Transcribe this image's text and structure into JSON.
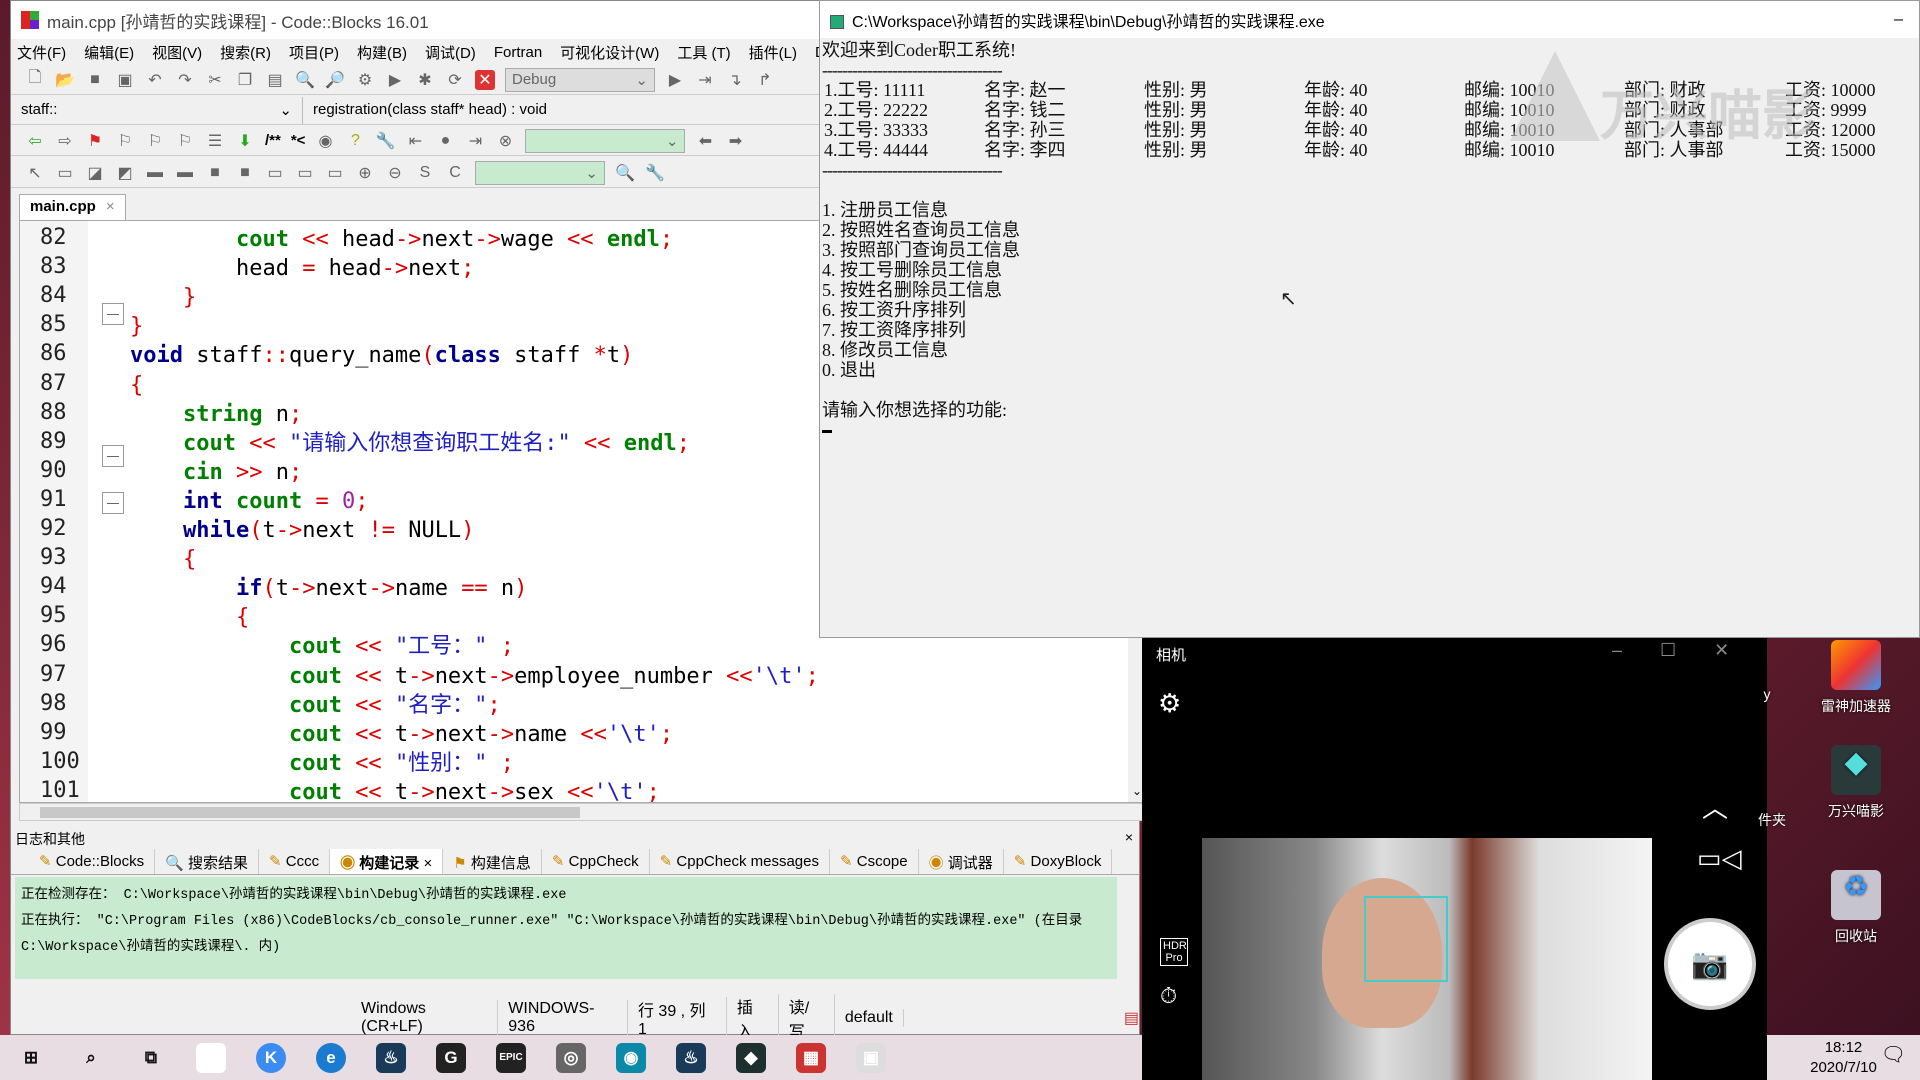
{
  "codeblocks": {
    "title": "main.cpp [孙靖哲的实践课程] - Code::Blocks 16.01",
    "menu": [
      "文件(F)",
      "编辑(E)",
      "视图(V)",
      "搜索(R)",
      "项目(P)",
      "构建(B)",
      "调试(D)",
      "Fortran",
      "可视化设计(W)",
      "工具 (T)",
      "插件(L)",
      "DoxyBl"
    ],
    "build_target": "Debug",
    "scope": "staff::",
    "function": "registration(class staff* head) : void",
    "doc_comment_buttons": [
      "/**",
      "*<"
    ],
    "file_tab": "main.cpp",
    "line_numbers": [
      "82",
      "83",
      "84",
      "85",
      "86",
      "87",
      "88",
      "89",
      "90",
      "91",
      "92",
      "93",
      "94",
      "95",
      "96",
      "97",
      "98",
      "99",
      "100",
      "101"
    ],
    "code": [
      [
        [
          "t",
          "        "
        ],
        [
          "g",
          "cout"
        ],
        [
          "t",
          " "
        ],
        [
          "o",
          "<<"
        ],
        [
          "t",
          " head"
        ],
        [
          "o",
          "->"
        ],
        [
          "t",
          "next"
        ],
        [
          "o",
          "->"
        ],
        [
          "t",
          "wage "
        ],
        [
          "o",
          "<<"
        ],
        [
          "t",
          " "
        ],
        [
          "g",
          "endl"
        ],
        [
          "o",
          ";"
        ]
      ],
      [
        [
          "t",
          "        head "
        ],
        [
          "o",
          "="
        ],
        [
          "t",
          " head"
        ],
        [
          "o",
          "->"
        ],
        [
          "t",
          "next"
        ],
        [
          "o",
          ";"
        ]
      ],
      [
        [
          "t",
          "    "
        ],
        [
          "o",
          "}"
        ]
      ],
      [
        [
          "o",
          "}"
        ]
      ],
      [
        [
          "k",
          "void"
        ],
        [
          "t",
          " staff"
        ],
        [
          "o",
          "::"
        ],
        [
          "t",
          "query_name"
        ],
        [
          "o",
          "("
        ],
        [
          "k",
          "class"
        ],
        [
          "t",
          " staff "
        ],
        [
          "o",
          "*"
        ],
        [
          "t",
          "t"
        ],
        [
          "o",
          ")"
        ]
      ],
      [
        [
          "o",
          "{"
        ]
      ],
      [
        [
          "t",
          "    "
        ],
        [
          "g",
          "string"
        ],
        [
          "t",
          " n"
        ],
        [
          "o",
          ";"
        ]
      ],
      [
        [
          "t",
          "    "
        ],
        [
          "g",
          "cout"
        ],
        [
          "t",
          " "
        ],
        [
          "o",
          "<<"
        ],
        [
          "t",
          " "
        ],
        [
          "s",
          "\"请输入你想查询职工姓名:\""
        ],
        [
          "t",
          " "
        ],
        [
          "o",
          "<<"
        ],
        [
          "t",
          " "
        ],
        [
          "g",
          "endl"
        ],
        [
          "o",
          ";"
        ]
      ],
      [
        [
          "t",
          "    "
        ],
        [
          "g",
          "cin"
        ],
        [
          "t",
          " "
        ],
        [
          "o",
          ">>"
        ],
        [
          "t",
          " n"
        ],
        [
          "o",
          ";"
        ]
      ],
      [
        [
          "t",
          "    "
        ],
        [
          "k",
          "int"
        ],
        [
          "t",
          " "
        ],
        [
          "g",
          "count"
        ],
        [
          "t",
          " "
        ],
        [
          "o",
          "="
        ],
        [
          "t",
          " "
        ],
        [
          "n",
          "0"
        ],
        [
          "o",
          ";"
        ]
      ],
      [
        [
          "t",
          "    "
        ],
        [
          "k",
          "while"
        ],
        [
          "o",
          "("
        ],
        [
          "t",
          "t"
        ],
        [
          "o",
          "->"
        ],
        [
          "t",
          "next "
        ],
        [
          "o",
          "!="
        ],
        [
          "t",
          " NULL"
        ],
        [
          "o",
          ")"
        ]
      ],
      [
        [
          "t",
          "    "
        ],
        [
          "o",
          "{"
        ]
      ],
      [
        [
          "t",
          "        "
        ],
        [
          "k",
          "if"
        ],
        [
          "o",
          "("
        ],
        [
          "t",
          "t"
        ],
        [
          "o",
          "->"
        ],
        [
          "t",
          "next"
        ],
        [
          "o",
          "->"
        ],
        [
          "t",
          "name "
        ],
        [
          "o",
          "=="
        ],
        [
          "t",
          " n"
        ],
        [
          "o",
          ")"
        ]
      ],
      [
        [
          "t",
          "        "
        ],
        [
          "o",
          "{"
        ]
      ],
      [
        [
          "t",
          "            "
        ],
        [
          "g",
          "cout"
        ],
        [
          "t",
          " "
        ],
        [
          "o",
          "<<"
        ],
        [
          "t",
          " "
        ],
        [
          "s",
          "\"工号：\""
        ],
        [
          "t",
          " "
        ],
        [
          "o",
          ";"
        ]
      ],
      [
        [
          "t",
          "            "
        ],
        [
          "g",
          "cout"
        ],
        [
          "t",
          " "
        ],
        [
          "o",
          "<<"
        ],
        [
          "t",
          " t"
        ],
        [
          "o",
          "->"
        ],
        [
          "t",
          "next"
        ],
        [
          "o",
          "->"
        ],
        [
          "t",
          "employee_number "
        ],
        [
          "o",
          "<<"
        ],
        [
          "s",
          "'\\t'"
        ],
        [
          "o",
          ";"
        ]
      ],
      [
        [
          "t",
          "            "
        ],
        [
          "g",
          "cout"
        ],
        [
          "t",
          " "
        ],
        [
          "o",
          "<<"
        ],
        [
          "t",
          " "
        ],
        [
          "s",
          "\"名字：\""
        ],
        [
          "o",
          ";"
        ]
      ],
      [
        [
          "t",
          "            "
        ],
        [
          "g",
          "cout"
        ],
        [
          "t",
          " "
        ],
        [
          "o",
          "<<"
        ],
        [
          "t",
          " t"
        ],
        [
          "o",
          "->"
        ],
        [
          "t",
          "next"
        ],
        [
          "o",
          "->"
        ],
        [
          "t",
          "name "
        ],
        [
          "o",
          "<<"
        ],
        [
          "s",
          "'\\t'"
        ],
        [
          "o",
          ";"
        ]
      ],
      [
        [
          "t",
          "            "
        ],
        [
          "g",
          "cout"
        ],
        [
          "t",
          " "
        ],
        [
          "o",
          "<<"
        ],
        [
          "t",
          " "
        ],
        [
          "s",
          "\"性别：\""
        ],
        [
          "t",
          " "
        ],
        [
          "o",
          ";"
        ]
      ],
      [
        [
          "t",
          "            "
        ],
        [
          "g",
          "cout"
        ],
        [
          "t",
          " "
        ],
        [
          "o",
          "<<"
        ],
        [
          "t",
          " t"
        ],
        [
          "o",
          "->"
        ],
        [
          "t",
          "next"
        ],
        [
          "o",
          "->"
        ],
        [
          "t",
          "sex "
        ],
        [
          "o",
          "<<"
        ],
        [
          "s",
          "'\\t'"
        ],
        [
          "o",
          ";"
        ]
      ]
    ],
    "log": {
      "title": "日志和其他",
      "tabs": [
        "Code::Blocks",
        "搜索结果",
        "Cccc",
        "构建记录",
        "构建信息",
        "CppCheck",
        "CppCheck messages",
        "Cscope",
        "调试器",
        "DoxyBlock"
      ],
      "active_tab": "构建记录",
      "lines": [
        "正在检测存在： C:\\Workspace\\孙靖哲的实践课程\\bin\\Debug\\孙靖哲的实践课程.exe",
        "正在执行： \"C:\\Program Files (x86)\\CodeBlocks/cb_console_runner.exe\" \"C:\\Workspace\\孙靖哲的实践课程\\bin\\Debug\\孙靖哲的实践课程.exe\"  (在目录 C:\\Workspace\\孙靖哲的实践课程\\. 内)"
      ]
    },
    "status": [
      "Windows (CR+LF)",
      "WINDOWS-936",
      "行 39 , 列 1",
      "插入",
      "读/写",
      "default"
    ]
  },
  "console": {
    "title": "C:\\Workspace\\孙靖哲的实践课程\\bin\\Debug\\孙靖哲的实践课程.exe",
    "welcome": "欢迎来到Coder职工系统!",
    "separator": "------------------------------------",
    "employees": [
      [
        "1.工号: 11111",
        "名字: 赵一",
        "性别: 男",
        "年龄: 40",
        "邮编: 10010",
        "部门: 财政",
        "工资: 10000"
      ],
      [
        "2.工号: 22222",
        "名字: 钱二",
        "性别: 男",
        "年龄: 40",
        "邮编: 10010",
        "部门: 财政",
        "工资: 9999"
      ],
      [
        "3.工号: 33333",
        "名字: 孙三",
        "性别: 男",
        "年龄: 40",
        "邮编: 10010",
        "部门: 人事部",
        "工资: 12000"
      ],
      [
        "4.工号: 44444",
        "名字: 李四",
        "性别: 男",
        "年龄: 40",
        "邮编: 10010",
        "部门: 人事部",
        "工资: 15000"
      ]
    ],
    "menu": [
      "1. 注册员工信息",
      "2. 按照姓名查询员工信息",
      "3. 按照部门查询员工信息",
      "4. 按工号删除员工信息",
      "5. 按姓名删除员工信息",
      "6. 按工资升序排列",
      "7. 按工资降序排列",
      "8. 修改员工信息",
      "0. 退出"
    ],
    "prompt": "请输入你想选择的功能:",
    "watermark": "万兴喵影"
  },
  "camera": {
    "title": "相机",
    "hdr": "HDR Pro",
    "accent": "#44cccc"
  },
  "desktop": {
    "icons": [
      "雷神加速器",
      "万兴喵影",
      "回收站"
    ],
    "partial": [
      "y",
      "件夹"
    ]
  },
  "taskbar": {
    "time": "18:12",
    "date": "2020/7/10",
    "apps": [
      "windows-start",
      "search",
      "task-view",
      "baidu-netdisk",
      "kugou",
      "edge",
      "steam",
      "gog-galaxy",
      "epic-games",
      "camera",
      "app-circle",
      "steam",
      "filmora",
      "codeblocks",
      "console"
    ]
  }
}
